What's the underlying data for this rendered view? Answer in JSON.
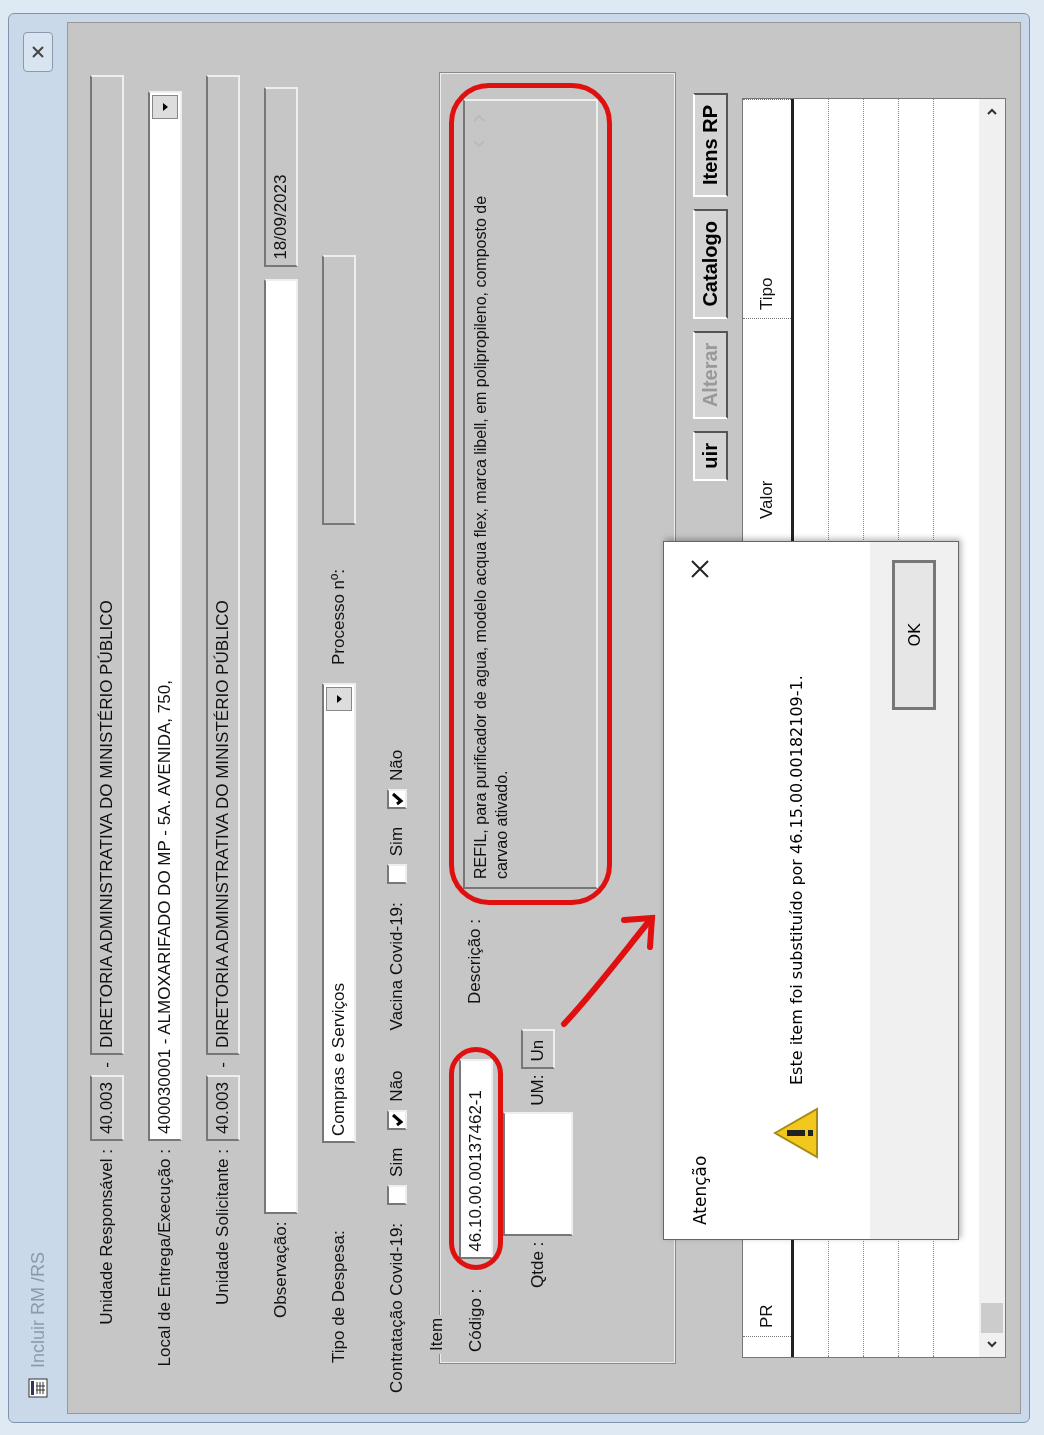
{
  "window": {
    "title": "Incluir RM /RS"
  },
  "unidade_responsavel": {
    "label": "Unidade Responsável :",
    "code": "40.003",
    "separator": "-",
    "name": "DIRETORIA ADMINISTRATIVA DO MINISTÉRIO PÚBLICO"
  },
  "local_entrega": {
    "label": "Local de Entrega/Execução :",
    "value": "400030001 - ALMOXARIFADO DO MP - 5A. AVENIDA, 750,"
  },
  "unidade_solicitante": {
    "label": "Unidade Solicitante :",
    "code": "40.003",
    "separator": "-",
    "name": "DIRETORIA ADMINISTRATIVA DO MINISTÉRIO PÚBLICO"
  },
  "observacao": {
    "label": "Observação:"
  },
  "date": "18/09/2023",
  "tipo_despesa": {
    "label": "Tipo de Despesa:",
    "value": "Compras e Serviços"
  },
  "processo": {
    "label": "Processo nº:"
  },
  "covid": [
    {
      "label": "Contratação Covid-19:",
      "options": [
        {
          "label": "Sim",
          "checked": false
        },
        {
          "label": "Não",
          "checked": true
        }
      ]
    },
    {
      "label": "Vacina Covid-19:",
      "options": [
        {
          "label": "Sim",
          "checked": false
        },
        {
          "label": "Não",
          "checked": true
        }
      ]
    }
  ],
  "item": {
    "title": "Item",
    "codigo_label": "Código :",
    "codigo": "46.10.00.00137462-1",
    "descricao_label": "Descrição :",
    "descricao": "REFIL, para purificador de agua, modelo acqua flex, marca libell, em polipropileno, composto de carvao ativado.",
    "qtde_label": "Qtde :",
    "um_label": "UM:",
    "um": "Un"
  },
  "buttons": [
    {
      "label": "uir",
      "disabled": false
    },
    {
      "label": "Alterar",
      "disabled": true
    },
    {
      "label": "Catalogo",
      "disabled": false
    },
    {
      "label": "Itens RP",
      "disabled": false
    }
  ],
  "table": {
    "columns": [
      "PR",
      "Valor",
      "Tipo"
    ]
  },
  "dialog": {
    "title": "Atenção",
    "message": "Este item foi substituído por 46.15.00.00182109-1.",
    "ok": "OK"
  }
}
